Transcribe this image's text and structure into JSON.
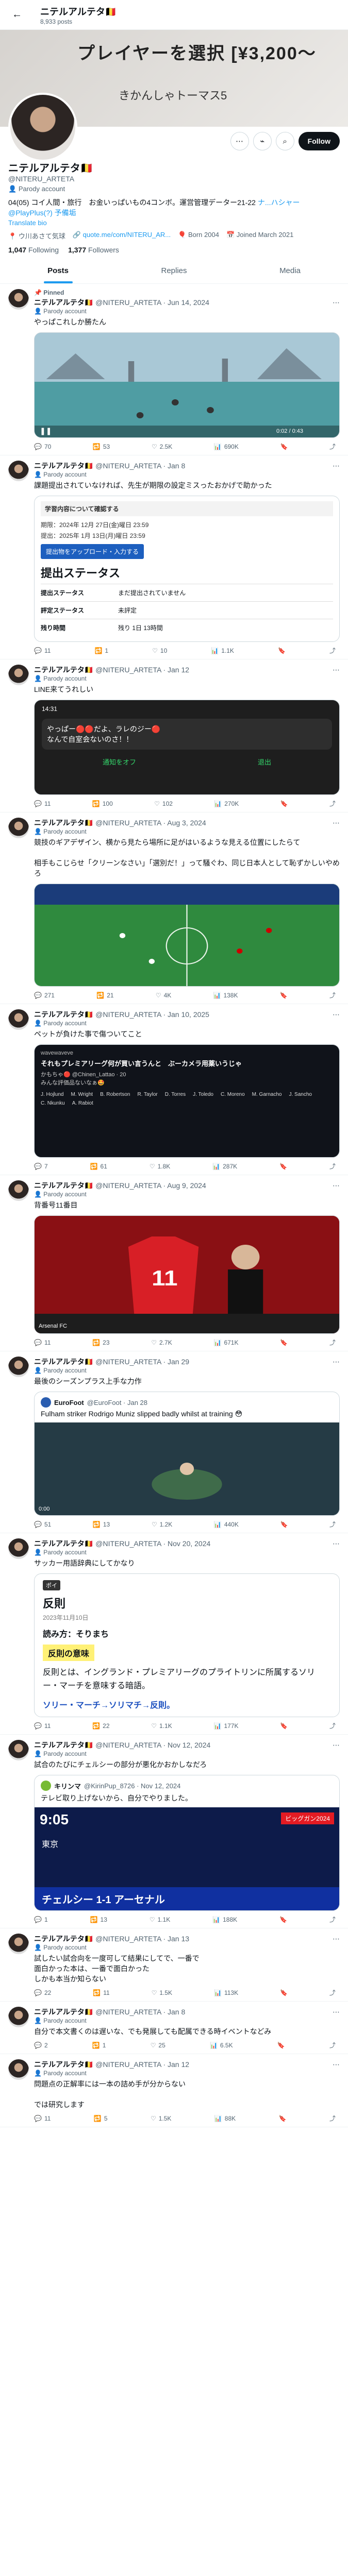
{
  "topbar": {
    "title": "ニテルアルテタ🇧🇪",
    "post_count": "8,933 posts"
  },
  "banner": {
    "line1": "プレイヤーを選択 [¥3,200〜",
    "line2": "きかんしゃトーマス5"
  },
  "profile": {
    "name": "ニテルアルテタ🇧🇪",
    "handle": "@NITERU_ARTETA",
    "parody": "Parody account",
    "bio_a": "04(05) コイ人間・旅行　お金いっぱいもの4コンボ。",
    "bio_b": "運営管理データー21-22 ",
    "bio_c": "ナ...ハシャー@PlayPlus(?) 予備垢",
    "translate": "Translate bio",
    "location": "ウ川あさて気球",
    "link": "quote.me/com/NITERU_AR...",
    "birth": "Born 2004",
    "joined": "Joined March 2021",
    "following_count": "1,047",
    "following_label": "Following",
    "followers_count": "1,377",
    "followers_label": "Followers",
    "follow_label": "Follow"
  },
  "tabs": [
    "Posts",
    "Replies",
    "Media"
  ],
  "posts": [
    {
      "pinned": "Pinned",
      "name": "ニテルアルテタ🇧🇪",
      "handle": "@NITERU_ARTETA · Jun 14, 2024",
      "parody": "Parody account",
      "text": "やっぱこれしか勝たん",
      "stats": [
        "70",
        "53",
        "2.5K",
        "690K"
      ]
    },
    {
      "name": "ニテルアルテタ🇧🇪",
      "handle": "@NITERU_ARTETA · Jan 8",
      "parody": "Parody account",
      "text": "課題提出されていなければ、先生が期限の設定ミスったおかげで助かった",
      "stats": [
        "11",
        "1",
        "10",
        "1.1K"
      ]
    },
    {
      "name": "ニテルアルテタ🇧🇪",
      "handle": "@NITERU_ARTETA · Jan 12",
      "parody": "Parody account",
      "text": "LINE来てうれしい",
      "stats": [
        "11",
        "100",
        "102",
        "270K"
      ]
    },
    {
      "name": "ニテルアルテタ🇧🇪",
      "handle": "@NITERU_ARTETA · Aug 3, 2024",
      "parody": "Parody account",
      "text": "競技のギアデザイン、横から見たら場所に足がはいるような見える位置にしたらて\n\n相手もこじらせ「クリーンなさい」「選別だ！」って騒ぐわ、同じ日本人として恥ずかしいやめろ",
      "stats": [
        "271",
        "21",
        "4K",
        "138K"
      ]
    },
    {
      "name": "ニテルアルテタ🇧🇪",
      "handle": "@NITERU_ARTETA · Jan 10, 2025",
      "parody": "Parody account",
      "text": "ペットが負けた事で傷ついてこと",
      "stats": [
        "7",
        "61",
        "1.8K",
        "287K"
      ]
    },
    {
      "name": "ニテルアルテタ🇧🇪",
      "handle": "@NITERU_ARTETA · Aug 9, 2024",
      "parody": "Parody account",
      "text": "背番号11番目",
      "stats": [
        "11",
        "23",
        "2.7K",
        "671K"
      ]
    },
    {
      "name": "ニテルアルテタ🇧🇪",
      "handle": "@NITERU_ARTETA · Jan 29",
      "parody": "Parody account",
      "text": "最後のシーズンプラス上手な力作",
      "stats": [
        "51",
        "13",
        "1.2K",
        "440K"
      ]
    },
    {
      "name": "ニテルアルテタ🇧🇪",
      "handle": "@NITERU_ARTETA · Nov 20, 2024",
      "parody": "Parody account",
      "text": "サッカー用語辞典にしてかなり",
      "stats": [
        "11",
        "22",
        "1.1K",
        "177K"
      ]
    },
    {
      "name": "ニテルアルテタ🇧🇪",
      "handle": "@NITERU_ARTETA · Nov 12, 2024",
      "parody": "Parody account",
      "text": "試合のたびにチェルシーの部分が悪化かおかしなだろ",
      "stats": [
        "1",
        "13",
        "1.1K",
        "188K"
      ]
    },
    {
      "name": "ニテルアルテタ🇧🇪",
      "handle": "@NITERU_ARTETA · Jan 13",
      "parody": "Parody account",
      "text": "試したい試合向を一度可して結果にしてで、一番で\n面白かった本は、一番で面白かった\nしかも本当か知らない",
      "stats": [
        "22",
        "11",
        "1.5K",
        "113K"
      ]
    },
    {
      "name": "ニテルアルテタ🇧🇪",
      "handle": "@NITERU_ARTETA · Jan 8",
      "parody": "Parody account",
      "text": "自分で本文書くのは遅いな、でも発展しても配属できる時イベントなどみ",
      "stats": [
        "2",
        "1",
        "25",
        "6.5K"
      ]
    },
    {
      "name": "ニテルアルテタ🇧🇪",
      "handle": "@NITERU_ARTETA · Jan 12",
      "parody": "Parody account",
      "text": "問題点の正解率には一本の詰め手が分からない\n\nでは研究します",
      "stats": [
        "11",
        "5",
        "1.5K",
        "88K"
      ]
    }
  ],
  "media": {
    "video_time": "0:02 / 0:43",
    "form_header": "学習内容について確認する",
    "form_row1": "期限：2024年 12月 27日(金)曜日 23:59",
    "form_row2": "提出：2025年 1月 13日(月)曜日 23:59",
    "form_button": "提出物をアップロード・入力する",
    "form_title": "提出ステータス",
    "form_k1": "提出ステータス",
    "form_v1": "まだ提出されていません",
    "form_k2": "評定ステータス",
    "form_v2": "未評定",
    "form_k3": "残り時間",
    "form_v3": "残り 1日 13時間",
    "line_time": "14:31",
    "line_msg": "やっぱー🔴🔴だよ、ラレのジー🔴\nなんで自室会ないのさ！！",
    "line_left": "通知をオフ",
    "line_right": "退出",
    "pack_tag": "wavewaveve",
    "pack_text": "それもプレミアリーグ何が買い言うんと　ぶーカメラ用薬いうじゃ",
    "pack_sub": "かもちゃ🔴 @Chinen_Lattao · 20\nみんな評価品ないなぁ🤩",
    "pack_names": [
      "J. Hojlund",
      "M. Wright",
      "B. Robertson",
      "R. Taylor",
      "D. Torres",
      "J. Toledo",
      "C. Moreno",
      "M. Garnacho",
      "J. Sancho",
      "C. Nkunku",
      "A. Rabiot"
    ],
    "kit_number": "11",
    "kit_caption": "Arsenal FC",
    "eurofoot_name": "EuroFoot",
    "eurofoot_handle": "@EuroFoot · Jan 28",
    "eurofoot_text": "Fulham striker Rodrigo Muniz slipped badly whilst at training 😳",
    "clip_time": "0:00",
    "doc_tag": "ポイ",
    "doc_title": "反則",
    "doc_date": "2023年11月10日",
    "doc_reading": "読み方：そりまち",
    "doc_meaning": "反則の意味",
    "doc_body": "反則とは、イングランド・プレミアリーグのプライトリンに所属するソリー・マーチを意味する暗語。",
    "doc_footer": "ソリー・マーチ→ソリマチ→反則。",
    "tv_name": "キリンマ",
    "tv_handle": "@KirinPup_8726 · Nov 12, 2024",
    "tv_text": "テレビ取り上げないから、自分でやりました。",
    "tv_time": "9:05",
    "tv_city": "東京",
    "tv_channel": "ビッグガン2024",
    "tv_score": "チェルシー 1-1 アーセナル"
  },
  "colors": {
    "accent": "#1d9bf0",
    "text": "#0f1419",
    "muted": "#536471"
  }
}
